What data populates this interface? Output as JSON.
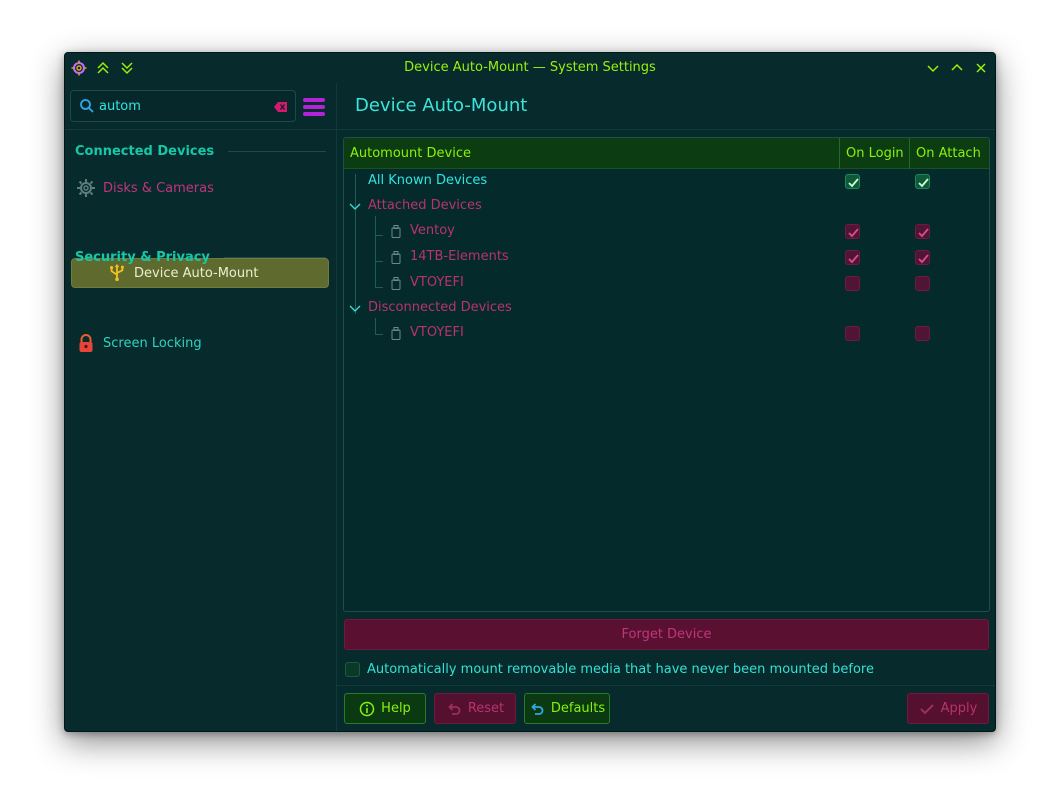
{
  "window": {
    "title": "Device Auto-Mount — System Settings"
  },
  "search": {
    "value": "autom"
  },
  "sidebar": {
    "sections": [
      {
        "label": "Connected Devices",
        "items": [
          {
            "label": "Disks & Cameras",
            "icon": "gear-icon"
          },
          {
            "label": "Device Auto-Mount",
            "icon": "usb-icon",
            "selected": true
          }
        ]
      },
      {
        "label": "Security & Privacy",
        "items": [
          {
            "label": "Screen Locking",
            "icon": "lock-icon"
          }
        ]
      }
    ]
  },
  "page": {
    "title": "Device Auto-Mount"
  },
  "table": {
    "columns": [
      "Automount Device",
      "On Login",
      "On Attach"
    ],
    "rows": [
      {
        "label": "All Known Devices",
        "on_login": true,
        "on_attach": true
      },
      {
        "label": "Attached Devices",
        "group": true
      },
      {
        "label": "Ventoy",
        "on_login": true,
        "on_attach": true
      },
      {
        "label": "14TB-Elements",
        "on_login": true,
        "on_attach": true
      },
      {
        "label": "VTOYEFI",
        "on_login": false,
        "on_attach": false
      },
      {
        "label": "Disconnected Devices",
        "group": true
      },
      {
        "label": "VTOYEFI",
        "on_login": false,
        "on_attach": false
      }
    ]
  },
  "actions": {
    "forget": "Forget Device",
    "auto_mount_label": "Automatically mount removable media that have never been mounted before",
    "auto_mount_checked": false
  },
  "buttons": {
    "help": "Help",
    "reset": "Reset",
    "defaults": "Defaults",
    "apply": "Apply"
  },
  "colors": {
    "accent_green": "#9bf00b",
    "accent_cyan": "#2ee6e0",
    "accent_magenta": "#c0367a",
    "background": "#072a2d"
  }
}
